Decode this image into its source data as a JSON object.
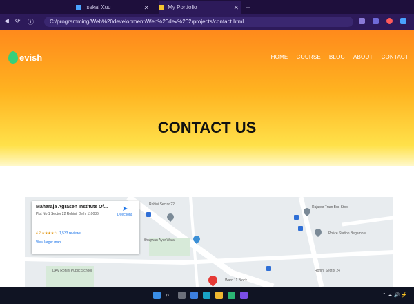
{
  "browser": {
    "tabs": [
      {
        "label": "Isekai Xuu",
        "color": "#4aa3ff"
      },
      {
        "label": "My Portfolio",
        "color": "#f4c430"
      }
    ],
    "address": "C:/programming/Web%20development/Web%20dev%202/projects/contact.html"
  },
  "site": {
    "logo_text": "evish",
    "nav": [
      "HOME",
      "COURSE",
      "BLOG",
      "ABOUT",
      "CONTACT"
    ],
    "page_title": "CONTACT US"
  },
  "map": {
    "place_name": "Maharaja Agrasen Institute Of...",
    "address": "Plot No 1 Sector 22 Rohini, Delhi 110086",
    "rating": "4.2 ★★★★☆",
    "reviews": "1,533 reviews",
    "view_larger": "View larger map",
    "directions": "Directions",
    "labels": [
      "Rohini Sector 22",
      "Bhagwan Ayur Wala",
      "Rajapur Tram Bus Stop",
      "Police Station Begampur",
      "DAV Rohini Public School",
      "Ward 11 Block",
      "Rohini Sector 24"
    ]
  },
  "colors": {
    "hero_top": "#ff8a1c",
    "hero_bottom": "#ffe14a",
    "logo_accent": "#35d07a"
  }
}
